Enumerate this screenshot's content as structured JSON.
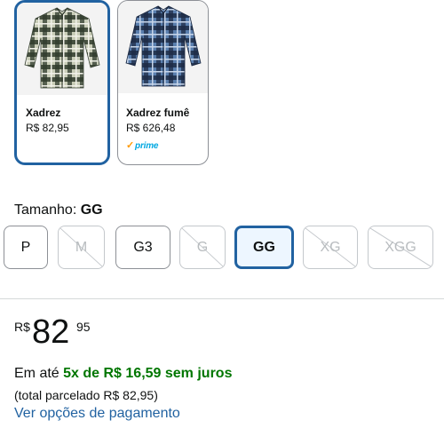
{
  "variants": [
    {
      "name": "Xadrez",
      "price": "R$ 82,95",
      "selected": true,
      "image_icon": "plaid-shirt-green-icon"
    },
    {
      "name": "Xadrez fumê",
      "price": "R$ 626,48",
      "selected": false,
      "badge": "prime",
      "image_icon": "plaid-shirt-blue-icon"
    }
  ],
  "size": {
    "label_prefix": "Tamanho:",
    "selected_value": "GG",
    "options": [
      {
        "label": "P",
        "available": true
      },
      {
        "label": "M",
        "available": false
      },
      {
        "label": "G3",
        "available": true
      },
      {
        "label": "G",
        "available": false
      },
      {
        "label": "GG",
        "available": true,
        "selected": true
      },
      {
        "label": "XG",
        "available": false
      },
      {
        "label": "XGG",
        "available": false
      }
    ]
  },
  "price": {
    "currency": "R$",
    "whole": "82",
    "cents": "95"
  },
  "installments": {
    "prefix": "Em até",
    "highlight": "5x de R$ 16,59 sem juros",
    "total": "(total parcelado R$ 82,95)",
    "link": "Ver opções de pagamento"
  },
  "colors": {
    "accent": "#2162a1",
    "green": "#007600",
    "prime_blue": "#00a8e1",
    "prime_check": "#ff9900"
  }
}
